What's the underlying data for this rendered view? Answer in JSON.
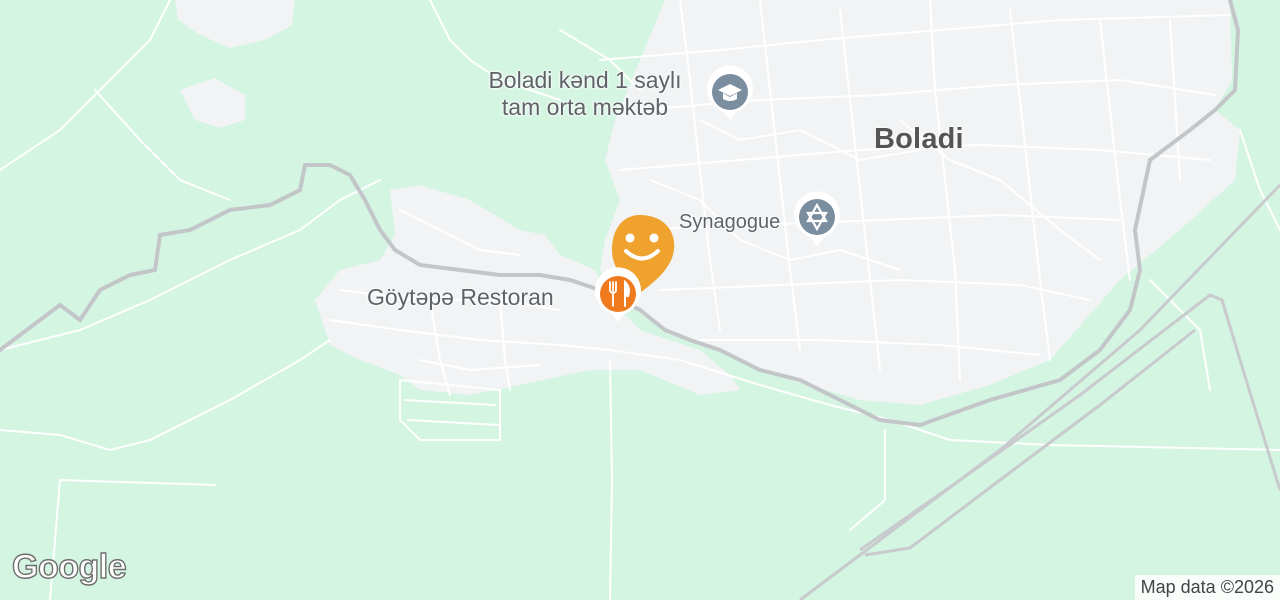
{
  "map": {
    "place_name": "Boladi",
    "pois": {
      "school": {
        "line1": "Boladi kənd 1 saylı",
        "line2": "tam orta məktəb",
        "icon": "school-icon"
      },
      "synagogue": {
        "name": "Synagogue",
        "icon": "star-of-david-icon"
      },
      "restaurant": {
        "name": "Göytəpə Restoran",
        "icon": "fork-knife-icon"
      }
    },
    "marker": {
      "icon": "smiley-icon",
      "color": "#f0a22e"
    },
    "attribution": "Map data ©2026",
    "logo": "Google",
    "colors": {
      "land": "#d4f5e2",
      "urban": "#f1f3f4",
      "road": "#ffffff",
      "railway": "#c6c9cc",
      "poi_gray": "#7b8ea0",
      "restaurant": "#f07b1e",
      "marker": "#f0a22e"
    }
  }
}
